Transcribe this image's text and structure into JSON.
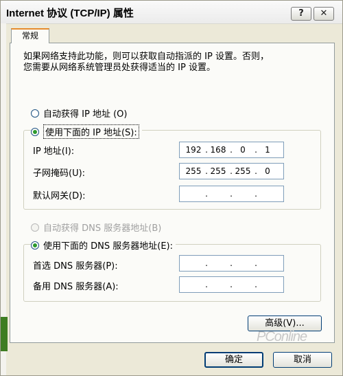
{
  "window": {
    "title": "Internet 协议 (TCP/IP) 属性",
    "help_label": "?",
    "close_label": "✕"
  },
  "tabs": [
    {
      "label": "常规",
      "selected": true
    }
  ],
  "description": "如果网络支持此功能，则可以获取自动指派的 IP 设置。否则，\n您需要从网络系统管理员处获得适当的 IP 设置。",
  "ip_section": {
    "auto_label": "自动获得 IP 地址 (O)",
    "manual_label": "使用下面的 IP 地址(S):",
    "selected": "manual",
    "fields": [
      {
        "label": "IP 地址(I):",
        "octets": [
          "192",
          "168",
          "0",
          "1"
        ]
      },
      {
        "label": "子网掩码(U):",
        "octets": [
          "255",
          "255",
          "255",
          "0"
        ]
      },
      {
        "label": "默认网关(D):",
        "octets": [
          "",
          "",
          "",
          ""
        ]
      }
    ]
  },
  "dns_section": {
    "auto_label": "自动获得 DNS 服务器地址(B)",
    "manual_label": "使用下面的 DNS 服务器地址(E):",
    "selected": "manual",
    "fields": [
      {
        "label": "首选 DNS 服务器(P):",
        "octets": [
          "",
          "",
          "",
          ""
        ]
      },
      {
        "label": "备用 DNS 服务器(A):",
        "octets": [
          "",
          "",
          "",
          ""
        ]
      }
    ]
  },
  "buttons": {
    "advanced": "高级(V)...",
    "ok": "确定",
    "cancel": "取消"
  },
  "watermark": "PConline",
  "colors": {
    "dialog_bg": "#ece9d8",
    "tab_accent": "#e68b2c",
    "radio_selected": "#2d9a2d",
    "input_border": "#7f9db9"
  }
}
